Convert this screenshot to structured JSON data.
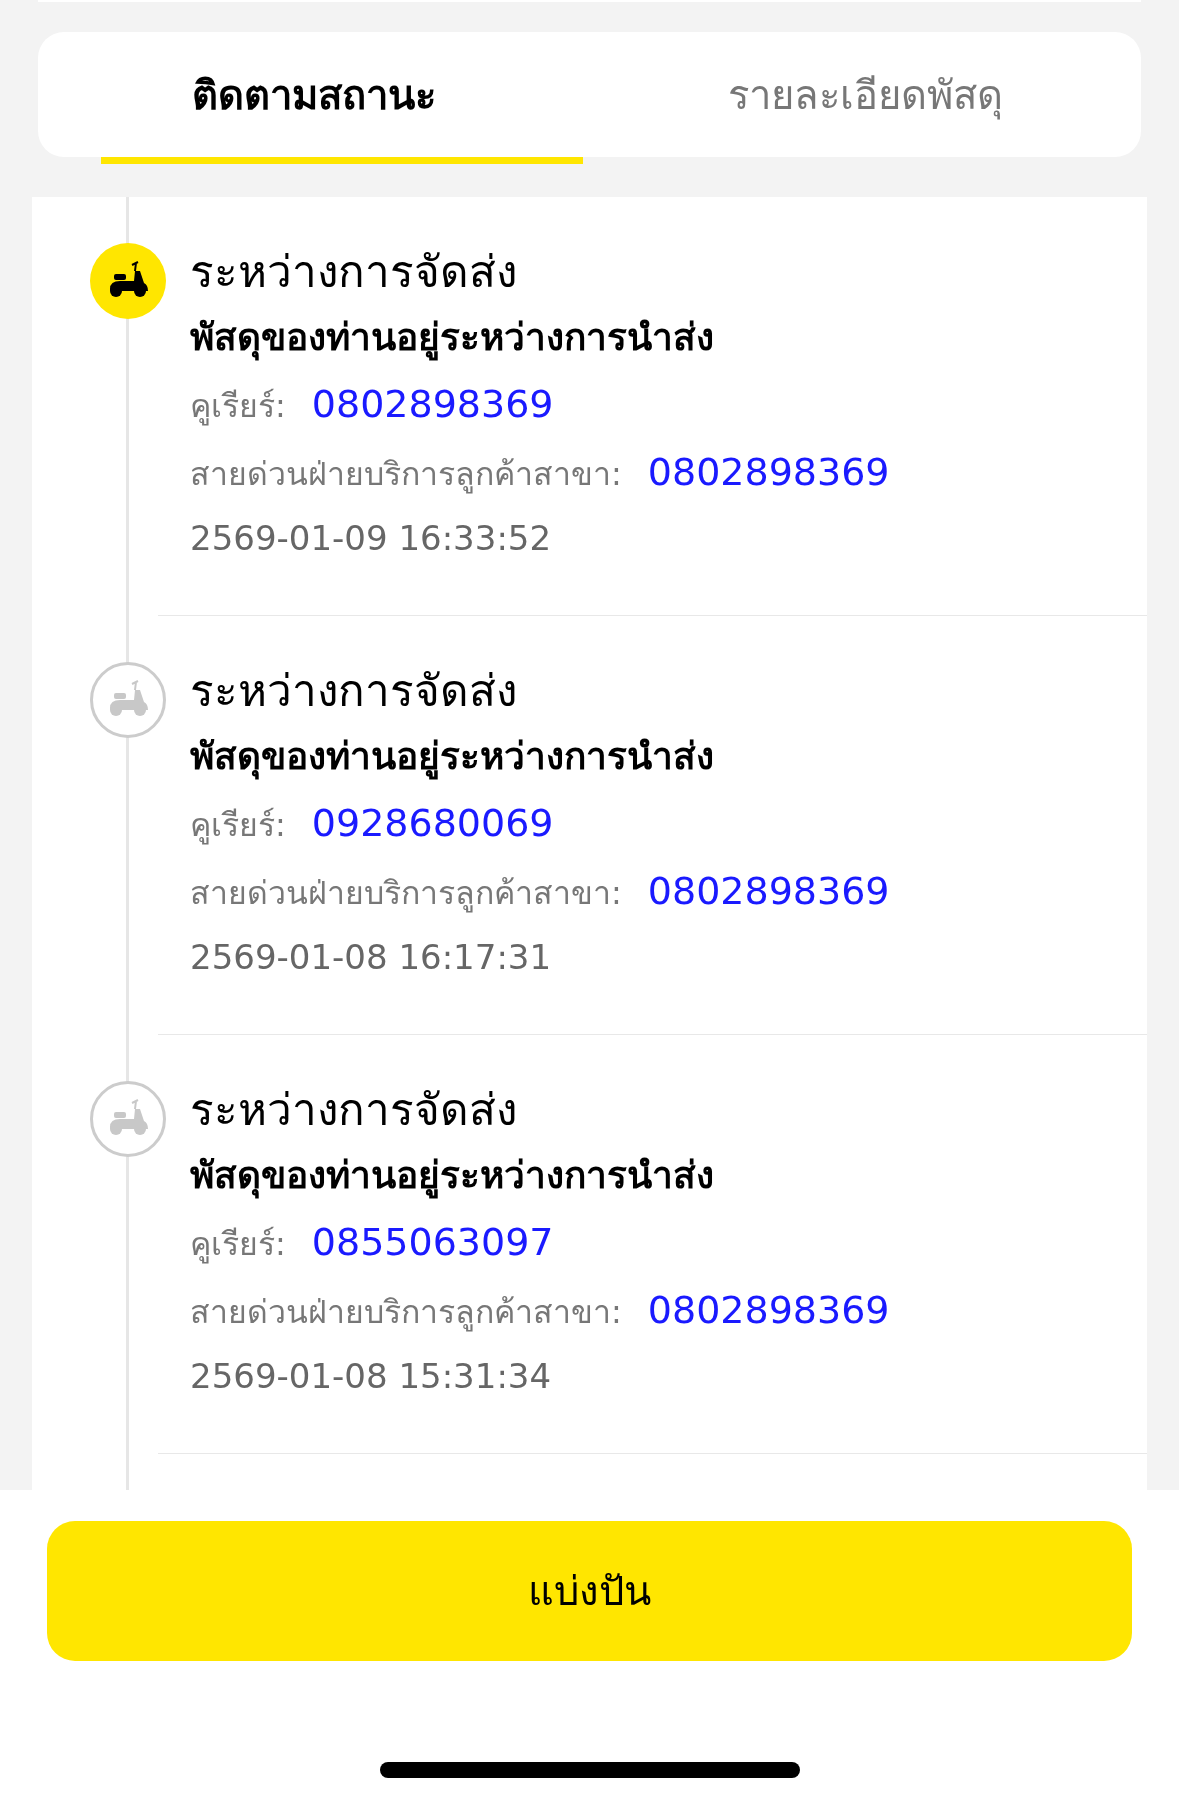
{
  "tabs": [
    {
      "label": "ติดตามสถานะ",
      "selected": true
    },
    {
      "label": "รายละเอียดพัสดุ",
      "selected": false
    }
  ],
  "events": [
    {
      "active": true,
      "status": "ระหว่างการจัดส่ง",
      "description": "พัสดุของท่านอยู่ระหว่างการนำส่ง",
      "courier_label": "คูเรียร์:",
      "courier_phone": "0802898369",
      "hotline_label": "สายด่วนฝ่ายบริการลูกค้าสาขา:",
      "hotline_phone": "0802898369",
      "time": "2569-01-09 16:33:52"
    },
    {
      "active": false,
      "status": "ระหว่างการจัดส่ง",
      "description": "พัสดุของท่านอยู่ระหว่างการนำส่ง",
      "courier_label": "คูเรียร์:",
      "courier_phone": "0928680069",
      "hotline_label": "สายด่วนฝ่ายบริการลูกค้าสาขา:",
      "hotline_phone": "0802898369",
      "time": "2569-01-08 16:17:31"
    },
    {
      "active": false,
      "status": "ระหว่างการจัดส่ง",
      "description": "พัสดุของท่านอยู่ระหว่างการนำส่ง",
      "courier_label": "คูเรียร์:",
      "courier_phone": "0855063097",
      "hotline_label": "สายด่วนฝ่ายบริการลูกค้าสาขา:",
      "hotline_phone": "0802898369",
      "time": "2569-01-08 15:31:34"
    }
  ],
  "share_button": "แบ่งปัน"
}
